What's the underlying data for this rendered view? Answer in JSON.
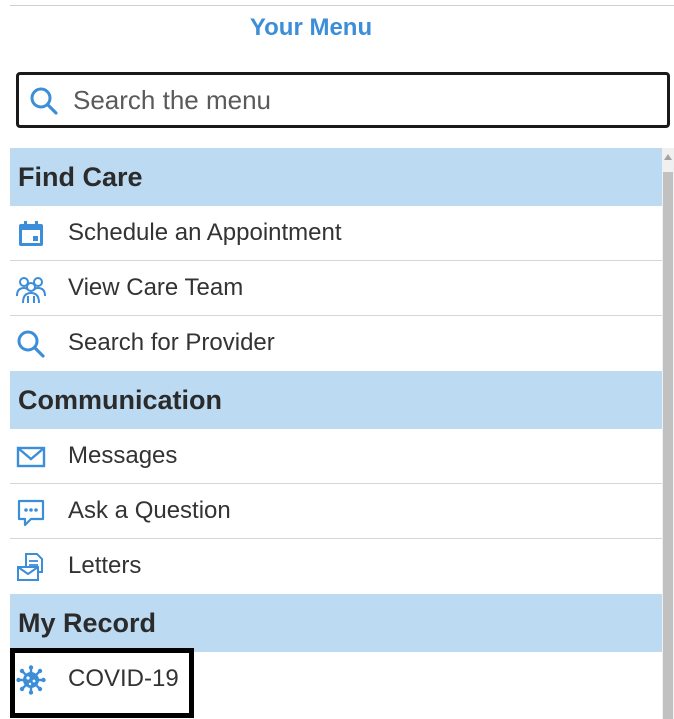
{
  "header": {
    "title": "Your Menu"
  },
  "search": {
    "placeholder": "Search the menu",
    "value": ""
  },
  "sections": [
    {
      "title": "Find Care",
      "items": [
        {
          "label": "Schedule an Appointment",
          "icon": "calendar-icon"
        },
        {
          "label": "View Care Team",
          "icon": "care-team-icon"
        },
        {
          "label": "Search for Provider",
          "icon": "search-icon"
        }
      ]
    },
    {
      "title": "Communication",
      "items": [
        {
          "label": "Messages",
          "icon": "envelope-icon"
        },
        {
          "label": "Ask a Question",
          "icon": "chat-bubble-icon"
        },
        {
          "label": "Letters",
          "icon": "letters-icon"
        }
      ]
    },
    {
      "title": "My Record",
      "items": [
        {
          "label": "COVID-19",
          "icon": "virus-icon"
        }
      ]
    }
  ],
  "colors": {
    "accent": "#3d8ed8",
    "section_header_bg": "#bcdaf2",
    "text": "#333333"
  }
}
